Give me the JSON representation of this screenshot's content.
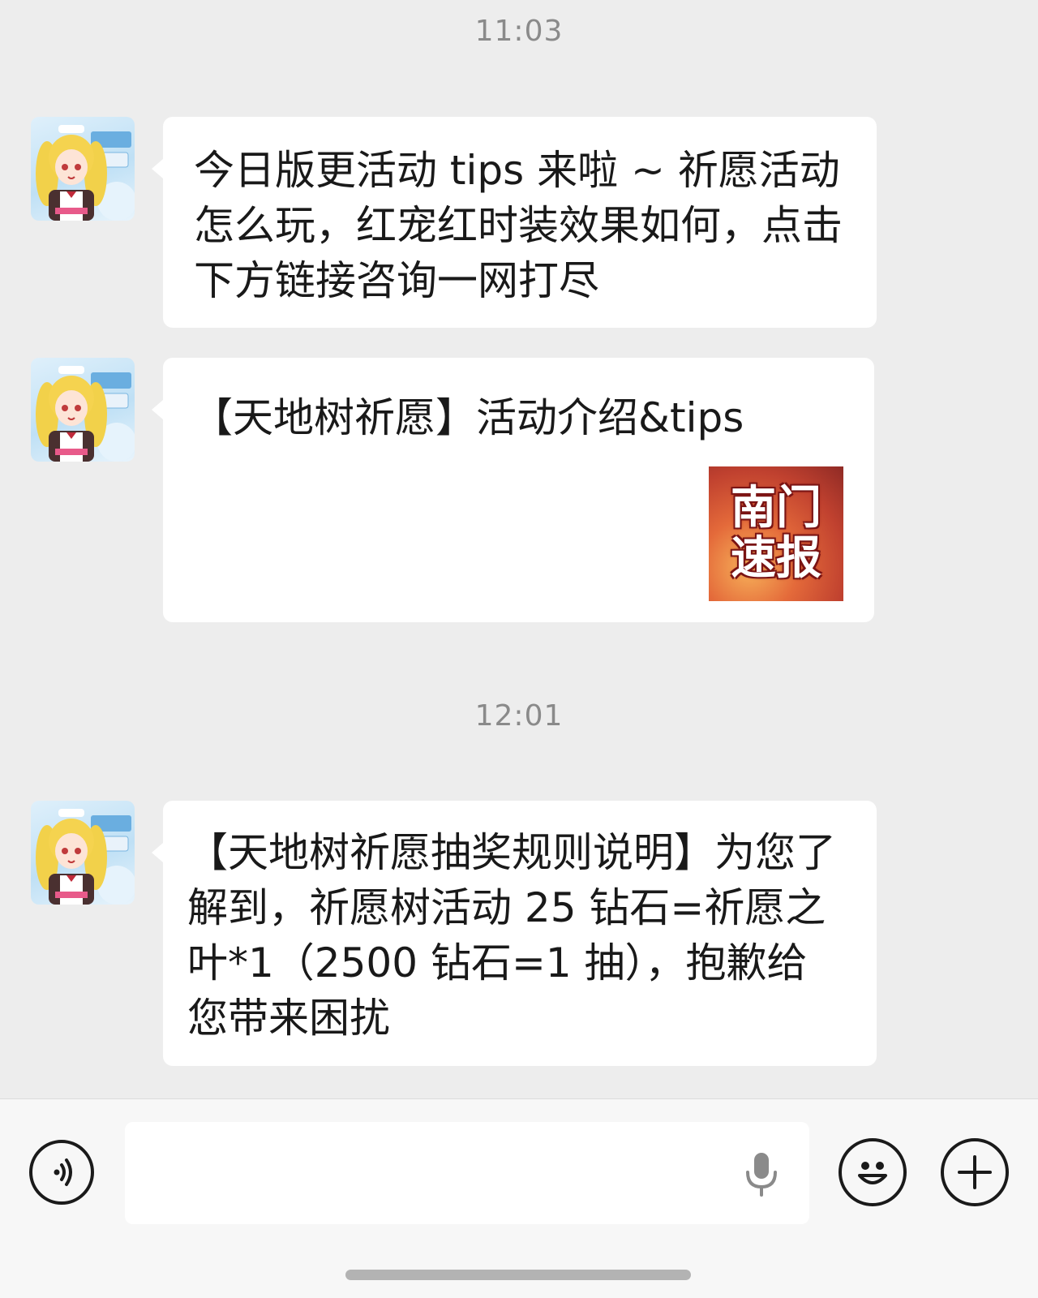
{
  "timestamps": [
    "11:03",
    "12:01"
  ],
  "sender": {
    "avatar_icon": "anime-girl-avatar"
  },
  "messages": [
    {
      "type": "text",
      "text": "今日版更活动 tips 来啦 ~ 祈愿活动怎么玩，红宠红时装效果如何，点击下方链接咨询一网打尽"
    },
    {
      "type": "link",
      "title": "【天地树祈愿】活动介绍&tips",
      "thumb_line1": "南门",
      "thumb_line2": "速报"
    },
    {
      "type": "text",
      "text": "【天地树祈愿抽奖规则说明】为您了解到，祈愿树活动 25 钻石=祈愿之叶*1（2500 钻石=1 抽），抱歉给您带来困扰"
    }
  ],
  "input_bar": {
    "voice_toggle_icon": "voice-icon",
    "mic_icon": "microphone-icon",
    "emoji_icon": "emoji-icon",
    "more_icon": "plus-icon",
    "input_value": ""
  }
}
